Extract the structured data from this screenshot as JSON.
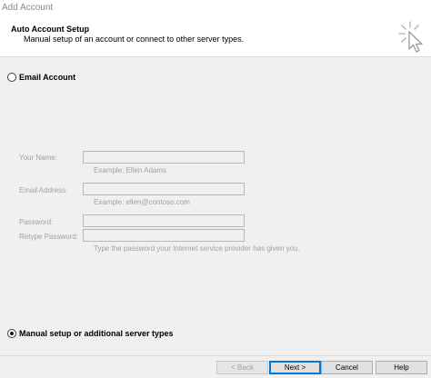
{
  "window": {
    "title": "Add Account"
  },
  "header": {
    "title": "Auto Account Setup",
    "subtitle": "Manual setup of an account or connect to other server types."
  },
  "email_account": {
    "label": "Email Account",
    "selected": false
  },
  "form": {
    "name": {
      "label": "Your Name:",
      "value": "",
      "hint": "Example: Ellen Adams"
    },
    "email": {
      "label": "Email Address:",
      "value": "",
      "hint": "Example: ellen@contoso.com"
    },
    "password": {
      "label": "Password:",
      "value": ""
    },
    "retype_password": {
      "label": "Retype Password:",
      "value": "",
      "hint": "Type the password your Internet service provider has given you."
    }
  },
  "manual_setup": {
    "label": "Manual setup or additional server types",
    "selected": true
  },
  "buttons": {
    "back": "< Back",
    "next": "Next >",
    "cancel": "Cancel",
    "help": "Help"
  },
  "icons": {
    "header": "wizard-cursor-icon"
  }
}
